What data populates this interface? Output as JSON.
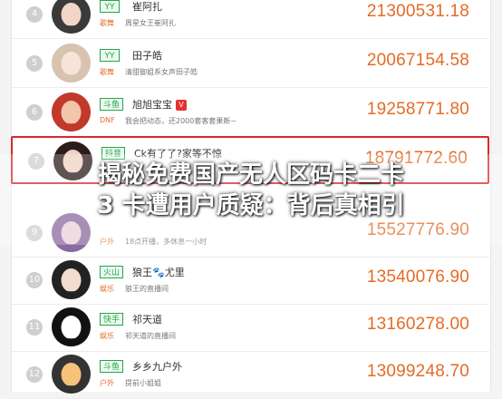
{
  "rows": [
    {
      "rank": "4",
      "tag": "YY",
      "nick": "崔阿扎",
      "category": "歌舞",
      "desc": "周星女王崔阿扎",
      "score": "21300531.18"
    },
    {
      "rank": "5",
      "tag": "YY",
      "nick": "田子皓",
      "category": "歌舞",
      "desc": "清甜御姐系女声田子皓",
      "score": "20067154.58"
    },
    {
      "rank": "6",
      "tag": "斗鱼",
      "nick": "旭旭宝宝",
      "verified": "V",
      "category": "DNF",
      "desc": "我会把动态，还2000套客套果断~",
      "score": "19258771.80"
    },
    {
      "rank": "7",
      "tag": "抖音",
      "nick": "Ck有了了?家等不惊",
      "category": "",
      "desc": "",
      "score": "18791772.60",
      "highlight": true
    },
    {
      "rank": "9",
      "tag": "",
      "nick": "",
      "category": "户外",
      "desc": "18点开播，多休息一小时",
      "score": "15527776.90"
    },
    {
      "rank": "10",
      "tag": "火山",
      "nick": "狼王🐾尤里",
      "category": "娱乐",
      "desc": "狼王的直播间",
      "score": "13540076.90"
    },
    {
      "rank": "11",
      "tag": "快手",
      "nick": "祁天道",
      "category": "娱乐",
      "desc": "祁天道的直播间",
      "score": "13160278.00"
    },
    {
      "rank": "12",
      "tag": "斗鱼",
      "nick": "乡乡九户外",
      "category": "户外",
      "desc": "提前小姐姐",
      "score": "13099248.70"
    }
  ],
  "overlay": {
    "line1": "揭秘免费国产无人区码卡二卡",
    "line2": "3 卡遭用户质疑：背后真相引"
  },
  "colors": {
    "accent": "#e46b25",
    "highlight_border": "#d9282d",
    "tag_green": "#22a64b"
  },
  "icons": {
    "rank": "rank-circle",
    "avatar": "avatar-photo",
    "verified": "verified-badge-icon"
  }
}
